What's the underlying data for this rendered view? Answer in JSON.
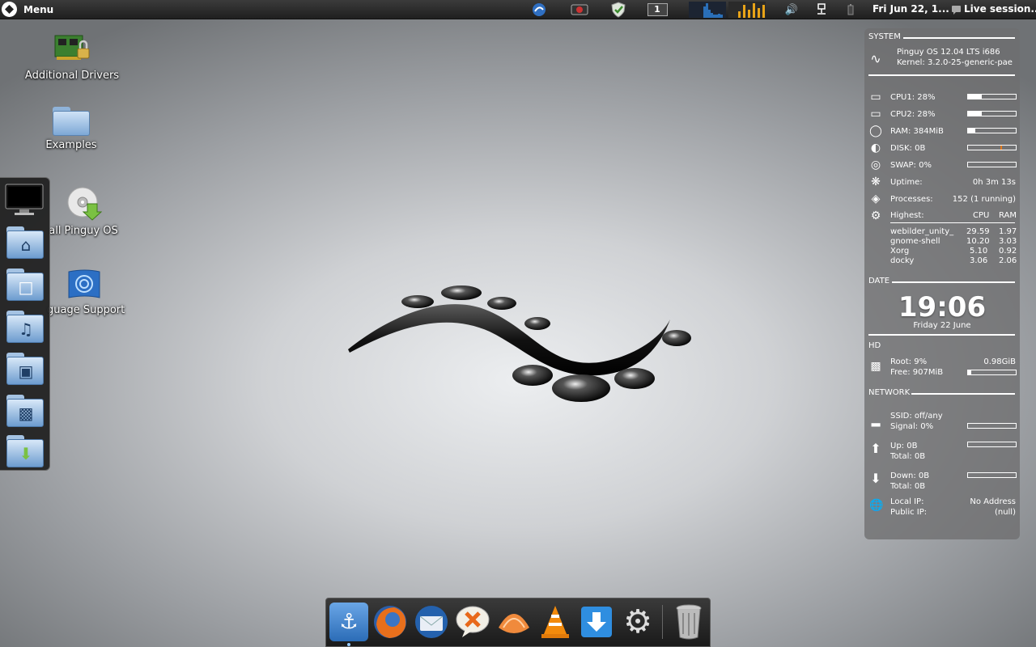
{
  "top_panel": {
    "menu_label": "Menu",
    "workspace": "1",
    "datetime": "Fri Jun 22, 1...",
    "session": "Live session..."
  },
  "desktop": {
    "icons": [
      {
        "label": "Additional Drivers"
      },
      {
        "label": "Examples"
      },
      {
        "label": "all Pinguy OS"
      },
      {
        "label": "guage Support"
      }
    ]
  },
  "colors": {
    "panel_bg": "#262626",
    "net_graph": "#2a6fb8",
    "cpu_graph": "#e8a317",
    "disk_marker": "#e07a1f"
  },
  "conky": {
    "system_header": "SYSTEM",
    "os": "Pinguy OS 12.04 LTS i686",
    "kernel": "Kernel: 3.2.0-25-generic-pae",
    "cpu1": "CPU1: 28%",
    "cpu2": "CPU2: 28%",
    "ram": "RAM: 384MiB",
    "disk": "DISK: 0B",
    "swap": "SWAP: 0%",
    "uptime_label": "Uptime:",
    "uptime_value": "0h 3m 13s",
    "processes_label": "Processes:",
    "processes_value": "152 (1 running)",
    "highest_label": "Highest:",
    "cpu_col": "CPU",
    "ram_col": "RAM",
    "procs": [
      {
        "name": "webilder_unity_",
        "cpu": "29.59",
        "ram": "1.97"
      },
      {
        "name": "gnome-shell",
        "cpu": "10.20",
        "ram": "3.03"
      },
      {
        "name": "Xorg",
        "cpu": "5.10",
        "ram": "0.92"
      },
      {
        "name": "docky",
        "cpu": "3.06",
        "ram": "2.06"
      }
    ],
    "date_header": "DATE",
    "time": "19:06",
    "date": "Friday 22 June",
    "hd_header": "HD",
    "root": "Root: 9%",
    "root_size": "0.98GiB",
    "free": "Free: 907MiB",
    "network_header": "NETWORK",
    "ssid": "SSID: off/any",
    "signal": "Signal: 0%",
    "up": "Up: 0B",
    "up_total": "Total: 0B",
    "down": "Down: 0B",
    "down_total": "Total: 0B",
    "local_ip_label": "Local IP:",
    "local_ip": "No Address",
    "public_ip_label": "Public IP:",
    "public_ip": "(null)",
    "bars": {
      "cpu1": 0.28,
      "cpu2": 0.28,
      "ram": 0.15,
      "disk": 0.0,
      "swap": 0.0,
      "hd_free": 0.07,
      "signal": 0.0,
      "up": 0.0,
      "down": 0.0
    }
  },
  "bottom_dock": {
    "items": [
      "docky-anchor-icon",
      "firefox-icon",
      "thunderbird-icon",
      "pidgin-icon",
      "clementine-icon",
      "vlc-icon",
      "download-icon",
      "settings-gear-icon",
      "trash-icon"
    ]
  }
}
